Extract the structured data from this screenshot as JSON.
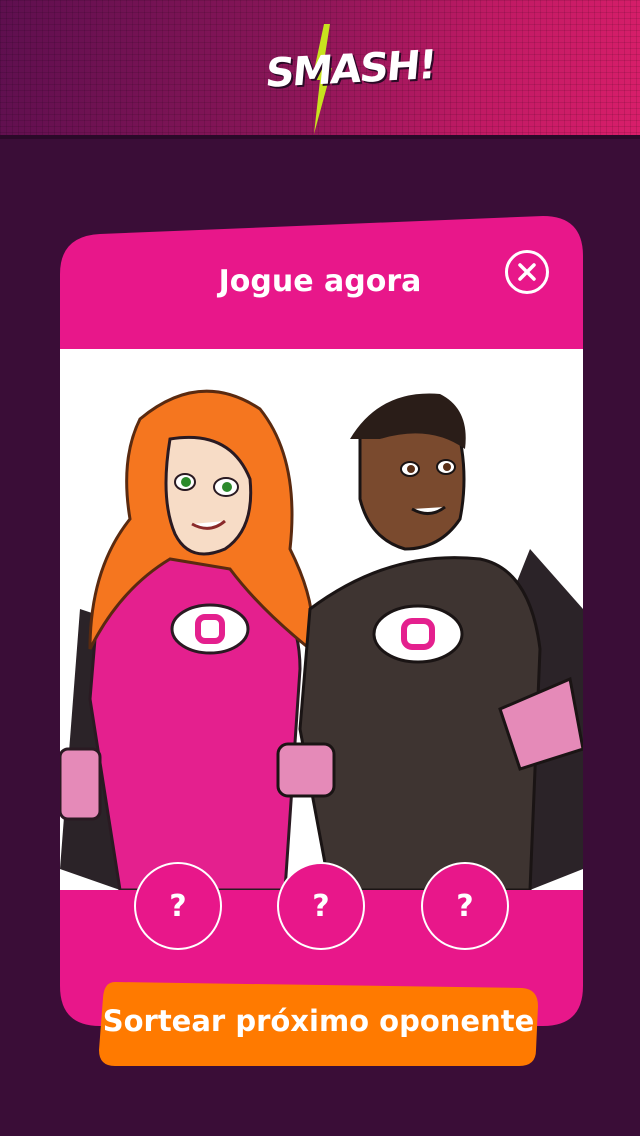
{
  "header": {
    "logo_text": "SMASH!"
  },
  "modal": {
    "title": "Jogue agora",
    "close_icon": "close-icon",
    "illustration": "two-superheroes-illustration",
    "opponent_slots": [
      "?",
      "?",
      "?"
    ],
    "draw_button_label": "Sortear próximo oponente"
  },
  "colors": {
    "background": "#3a0d37",
    "card_pink": "#e8178a",
    "button_orange": "#ff7a00",
    "header_magenta": "#c01a64"
  }
}
